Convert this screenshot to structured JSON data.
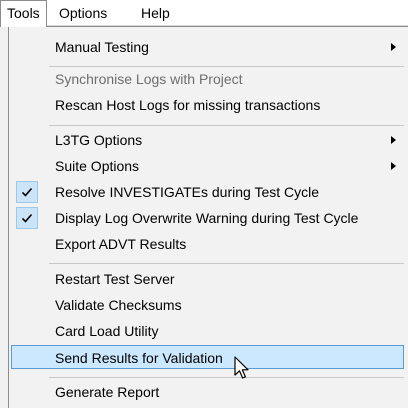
{
  "menubar": {
    "items": [
      {
        "label": "Tools"
      },
      {
        "label": "Options"
      },
      {
        "label": "Help"
      }
    ]
  },
  "menu": {
    "manual_testing": "Manual Testing",
    "synchronise_logs": "Synchronise Logs with Project",
    "rescan_host_logs": "Rescan Host Logs for missing transactions",
    "l3tg_options": "L3TG Options",
    "suite_options": "Suite Options",
    "resolve_investigates": "Resolve INVESTIGATEs during Test Cycle",
    "display_log_overwrite": "Display Log Overwrite Warning during Test Cycle",
    "export_advt": "Export ADVT Results",
    "restart_test_server": "Restart Test Server",
    "validate_checksums": "Validate Checksums",
    "card_load_utility": "Card Load Utility",
    "send_results": "Send Results for Validation",
    "generate_report": "Generate Report"
  },
  "colors": {
    "highlight_bg": "#cce8ff",
    "highlight_border": "#5b9bd5",
    "check_bg": "#cce4f7",
    "disabled_text": "#6d6d6d"
  },
  "icons": {
    "submenu": "chevron-right-icon",
    "checked": "checkmark-icon",
    "pointer": "mouse-cursor-icon"
  }
}
